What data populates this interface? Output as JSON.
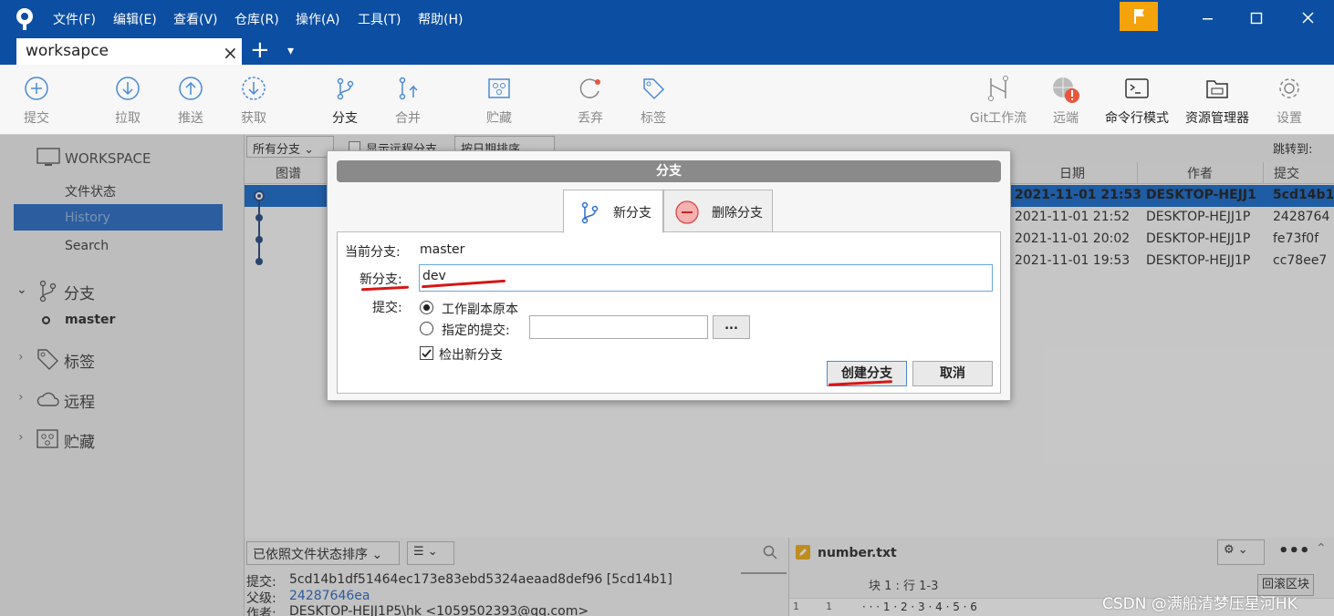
{
  "menu": {
    "items": [
      "文件(F)",
      "编辑(E)",
      "查看(V)",
      "仓库(R)",
      "操作(A)",
      "工具(T)",
      "帮助(H)"
    ]
  },
  "tabs": {
    "active": "worksapce",
    "close_glyph": "×",
    "add_glyph": "+",
    "more_glyph": "▾"
  },
  "toolbar": {
    "buttons": [
      {
        "label": "提交",
        "icon": "plus-circle-icon"
      },
      {
        "label": "拉取",
        "icon": "arrow-down-circle-icon"
      },
      {
        "label": "推送",
        "icon": "arrow-up-circle-icon"
      },
      {
        "label": "获取",
        "icon": "dashed-down-circle-icon"
      },
      {
        "label": "分支",
        "icon": "branch-icon"
      },
      {
        "label": "合并",
        "icon": "merge-icon"
      },
      {
        "label": "贮藏",
        "icon": "stash-icon"
      },
      {
        "label": "丢弃",
        "icon": "discard-icon"
      },
      {
        "label": "标签",
        "icon": "tag-icon"
      },
      {
        "label": "Git工作流",
        "icon": "git-flow-icon"
      },
      {
        "label": "远端",
        "icon": "globe-icon"
      },
      {
        "label": "命令行模式",
        "icon": "terminal-icon"
      },
      {
        "label": "资源管理器",
        "icon": "explorer-icon"
      },
      {
        "label": "设置",
        "icon": "gear-icon"
      }
    ]
  },
  "sidebar": {
    "workspace": "WORKSPACE",
    "views": [
      "文件状态",
      "History",
      "Search"
    ],
    "branches_header": "分支",
    "branches": [
      "master"
    ],
    "tags_header": "标签",
    "remotes_header": "远程",
    "stashes_header": "贮藏"
  },
  "filter": {
    "branch_filter": "所有分支",
    "show_remote": "显示远程分支",
    "sort": "按日期排序",
    "jump_to": "跳转到:"
  },
  "history": {
    "columns": {
      "graph": "图谱",
      "date": "日期",
      "author": "作者",
      "commit": "提交"
    },
    "rows": [
      {
        "date": "2021-11-01 21:53",
        "author": "DESKTOP-HEJJ1",
        "commit": "5cd14b1"
      },
      {
        "date": "2021-11-01 21:52",
        "author": "DESKTOP-HEJJ1P",
        "commit": "2428764"
      },
      {
        "date": "2021-11-01 20:02",
        "author": "DESKTOP-HEJJ1P",
        "commit": "fe73f0f"
      },
      {
        "date": "2021-11-01 19:53",
        "author": "DESKTOP-HEJJ1P",
        "commit": "cc78ee7"
      }
    ]
  },
  "dialog": {
    "title": "分支",
    "tab_new": "新分支",
    "tab_delete": "删除分支",
    "current_branch_label": "当前分支:",
    "current_branch_value": "master",
    "new_branch_label": "新分支:",
    "new_branch_value": "dev",
    "commit_label": "提交:",
    "radio_working_copy": "工作副本原本",
    "radio_specified": "指定的提交:",
    "browse_label": "...",
    "checkout_label": "检出新分支",
    "create_button": "创建分支",
    "cancel_button": "取消"
  },
  "bottom": {
    "sort_label": "已依照文件状态排序",
    "commit_line_label": "提交:",
    "commit_line_value": "5cd14b1df51464ec173e83ebd5324aeaad8def96 [5cd14b1]",
    "parent_label": "父级:",
    "parent_value": "24287646ea",
    "author_label": "作者:",
    "author_value": "DESKTOP-HEJJ1P5\\hk <1059502393@qq.com>",
    "file_name": "number.txt",
    "hunk_label": "块 1 : 行 1-3",
    "revert_hunk": "回滚区块",
    "diff_line_old": "1",
    "diff_line_new": "1",
    "diff_text": "· · · 1 · 2 · 3 · 4 · 5 · 6"
  },
  "watermark": "CSDN @满船清梦压星河HK",
  "colors": {
    "titlebar": "#0b4ea2",
    "selection": "#0a62c9",
    "flag": "#f4a30b",
    "annotation_red": "#d61717"
  }
}
